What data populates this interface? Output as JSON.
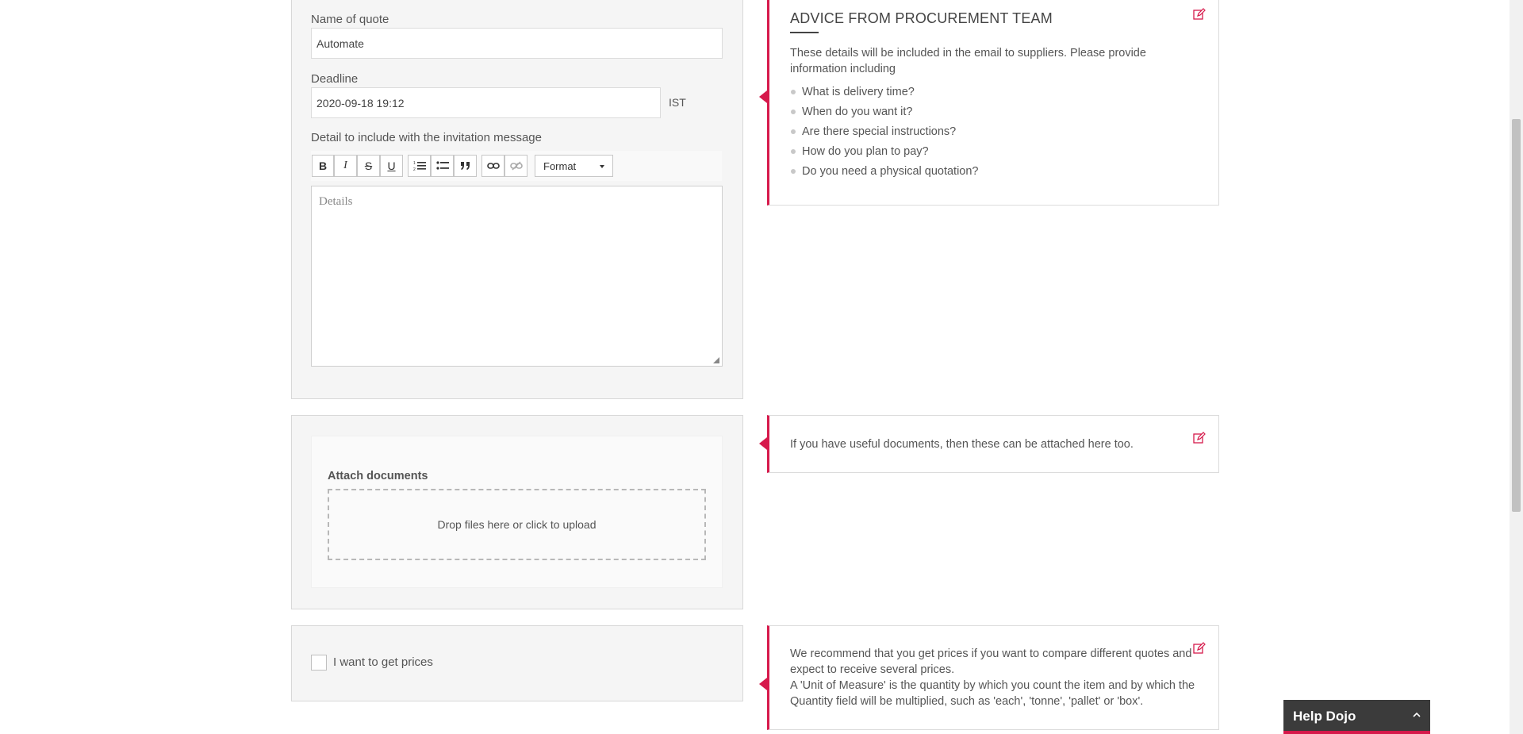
{
  "form": {
    "quote_name_label": "Name of quote",
    "quote_name_value": "Automate",
    "deadline_label": "Deadline",
    "deadline_value": "2020-09-18 19:12",
    "timezone": "IST",
    "detail_label": "Detail to include with the invitation message",
    "details_placeholder": "Details",
    "toolbar": {
      "bold": "B",
      "italic": "I",
      "strike": "S",
      "underline": "U",
      "format_label": "Format"
    },
    "attach_label": "Attach documents",
    "dropzone_text": "Drop files here or click to upload",
    "prices_label": "I want to get prices"
  },
  "advice": {
    "title": "ADVICE FROM PROCUREMENT TEAM",
    "intro": "These details will be included in the email to suppliers. Please provide information including",
    "items": [
      "What is delivery time?",
      "When do you want it?",
      "Are there special instructions?",
      "How do you plan to pay?",
      "Do you need a physical quotation?"
    ],
    "attach_text": "If you have useful documents, then these can be attached here too.",
    "prices_text_1": "We recommend that you get prices if you want to compare different quotes and expect to receive several prices.",
    "prices_text_2": "A 'Unit of Measure' is the quantity by which you count the item and by which the Quantity field will be multiplied, such as 'each', 'tonne', 'pallet' or 'box'."
  },
  "help_widget": {
    "title": "Help Dojo"
  },
  "colors": {
    "accent": "#d6194b",
    "panel_bg": "#f5f5f5",
    "help_bg": "#3b3b3b"
  }
}
